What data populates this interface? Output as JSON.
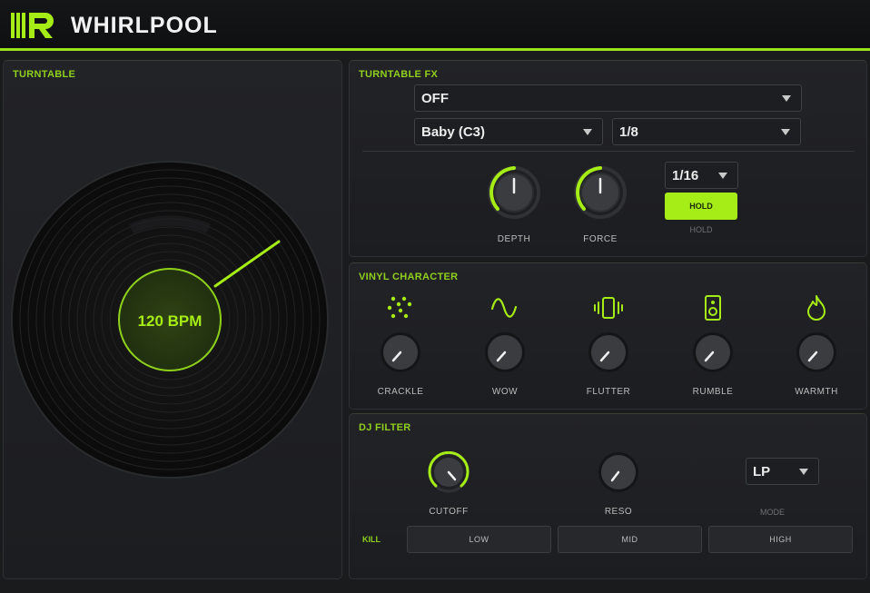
{
  "app": {
    "title": "WHIRLPOOL",
    "accent": "#a6ec16"
  },
  "turntable": {
    "title": "TURNTABLE",
    "bpm": "120 BPM"
  },
  "fx": {
    "title": "TURNTABLE FX",
    "effect_select": "OFF",
    "note_select": "Baby  (C3)",
    "rate_select": "1/8",
    "step_select": "1/16",
    "knobs": [
      {
        "label": "DEPTH",
        "value": 0.5
      },
      {
        "label": "FORCE",
        "value": 0.5
      }
    ],
    "hold_button": "HOLD",
    "hold_label": "HOLD"
  },
  "vinyl": {
    "title": "VINYL CHARACTER",
    "knobs": [
      {
        "label": "CRACKLE",
        "icon": "crackle-dots-icon"
      },
      {
        "label": "WOW",
        "icon": "sine-wave-icon"
      },
      {
        "label": "FLUTTER",
        "icon": "vibrate-icon"
      },
      {
        "label": "RUMBLE",
        "icon": "speaker-icon"
      },
      {
        "label": "WARMTH",
        "icon": "flame-icon"
      }
    ]
  },
  "filter": {
    "title": "DJ FILTER",
    "cutoff_label": "CUTOFF",
    "reso_label": "RESO",
    "mode_select": "LP",
    "mode_label": "MODE",
    "kill_label": "KILL",
    "kill_buttons": [
      "LOW",
      "MID",
      "HIGH"
    ]
  }
}
